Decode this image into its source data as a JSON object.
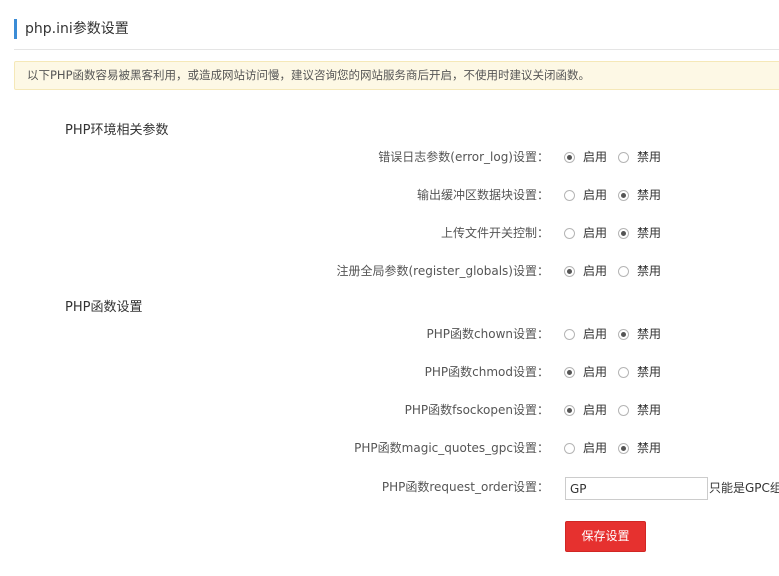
{
  "header": {
    "title": "php.ini参数设置",
    "accent_color": "#3b8cd6"
  },
  "notice": {
    "text": "以下PHP函数容易被黑客利用，或造成网站访问慢，建议咨询您的网站服务商后开启，不使用时建议关闭函数。",
    "background_color": "#fdf8e5"
  },
  "option_labels": {
    "enable": "启用",
    "disable": "禁用"
  },
  "sections": [
    {
      "title": "PHP环境相关参数",
      "rows": [
        {
          "label": "错误日志参数(error_log)设置：",
          "selected": "enable"
        },
        {
          "label": "输出缓冲区数据块设置：",
          "selected": "disable"
        },
        {
          "label": "上传文件开关控制：",
          "selected": "disable"
        },
        {
          "label": "注册全局参数(register_globals)设置：",
          "selected": "enable"
        }
      ]
    },
    {
      "title": "PHP函数设置",
      "rows": [
        {
          "label": "PHP函数chown设置：",
          "selected": "disable"
        },
        {
          "label": "PHP函数chmod设置：",
          "selected": "enable"
        },
        {
          "label": "PHP函数fsockopen设置：",
          "selected": "enable"
        },
        {
          "label": "PHP函数magic_quotes_gpc设置：",
          "selected": "disable"
        }
      ]
    }
  ],
  "request_order": {
    "label": "PHP函数request_order设置：",
    "value": "GP",
    "hint": "只能是GPC组"
  },
  "save_button": {
    "label": "保存设置",
    "color": "#e6312f"
  }
}
